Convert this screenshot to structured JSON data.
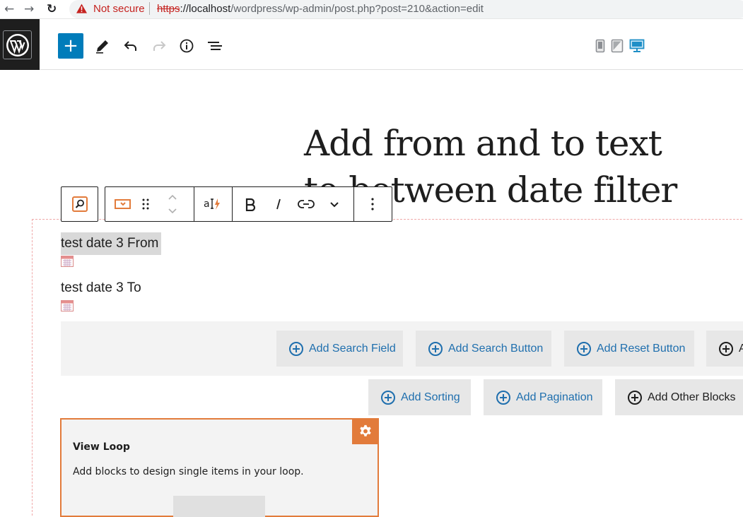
{
  "browser": {
    "security_label": "Not secure",
    "url_scheme": "https",
    "url_host": "://localhost",
    "url_path": "/wordpress/wp-admin/post.php?post=210&action=edit"
  },
  "toolbar": {
    "inserter_label": "+",
    "icons": [
      "wordpress-logo-icon",
      "pencil-icon",
      "undo-icon",
      "redo-icon",
      "info-icon",
      "list-view-icon",
      "mobile-preview-icon",
      "tablet-preview-icon",
      "desktop-preview-icon"
    ]
  },
  "post": {
    "title": "Add from and to text to between date filter"
  },
  "filters": {
    "from_label": "test date 3 From",
    "to_label": "test date 3 To"
  },
  "search_row": {
    "buttons": [
      "Add Search Field",
      "Add Search Button",
      "Add Reset Button",
      "A"
    ]
  },
  "extra_row": {
    "buttons": [
      "Add Sorting",
      "Add Pagination",
      "Add Other Blocks"
    ]
  },
  "view_loop": {
    "title": "View Loop",
    "description": "Add blocks to design single items in your loop."
  },
  "colors": {
    "accent": "#007cba",
    "link_blue": "#1f6fae",
    "loop_orange": "#e27b3b",
    "danger": "#c5221f"
  }
}
